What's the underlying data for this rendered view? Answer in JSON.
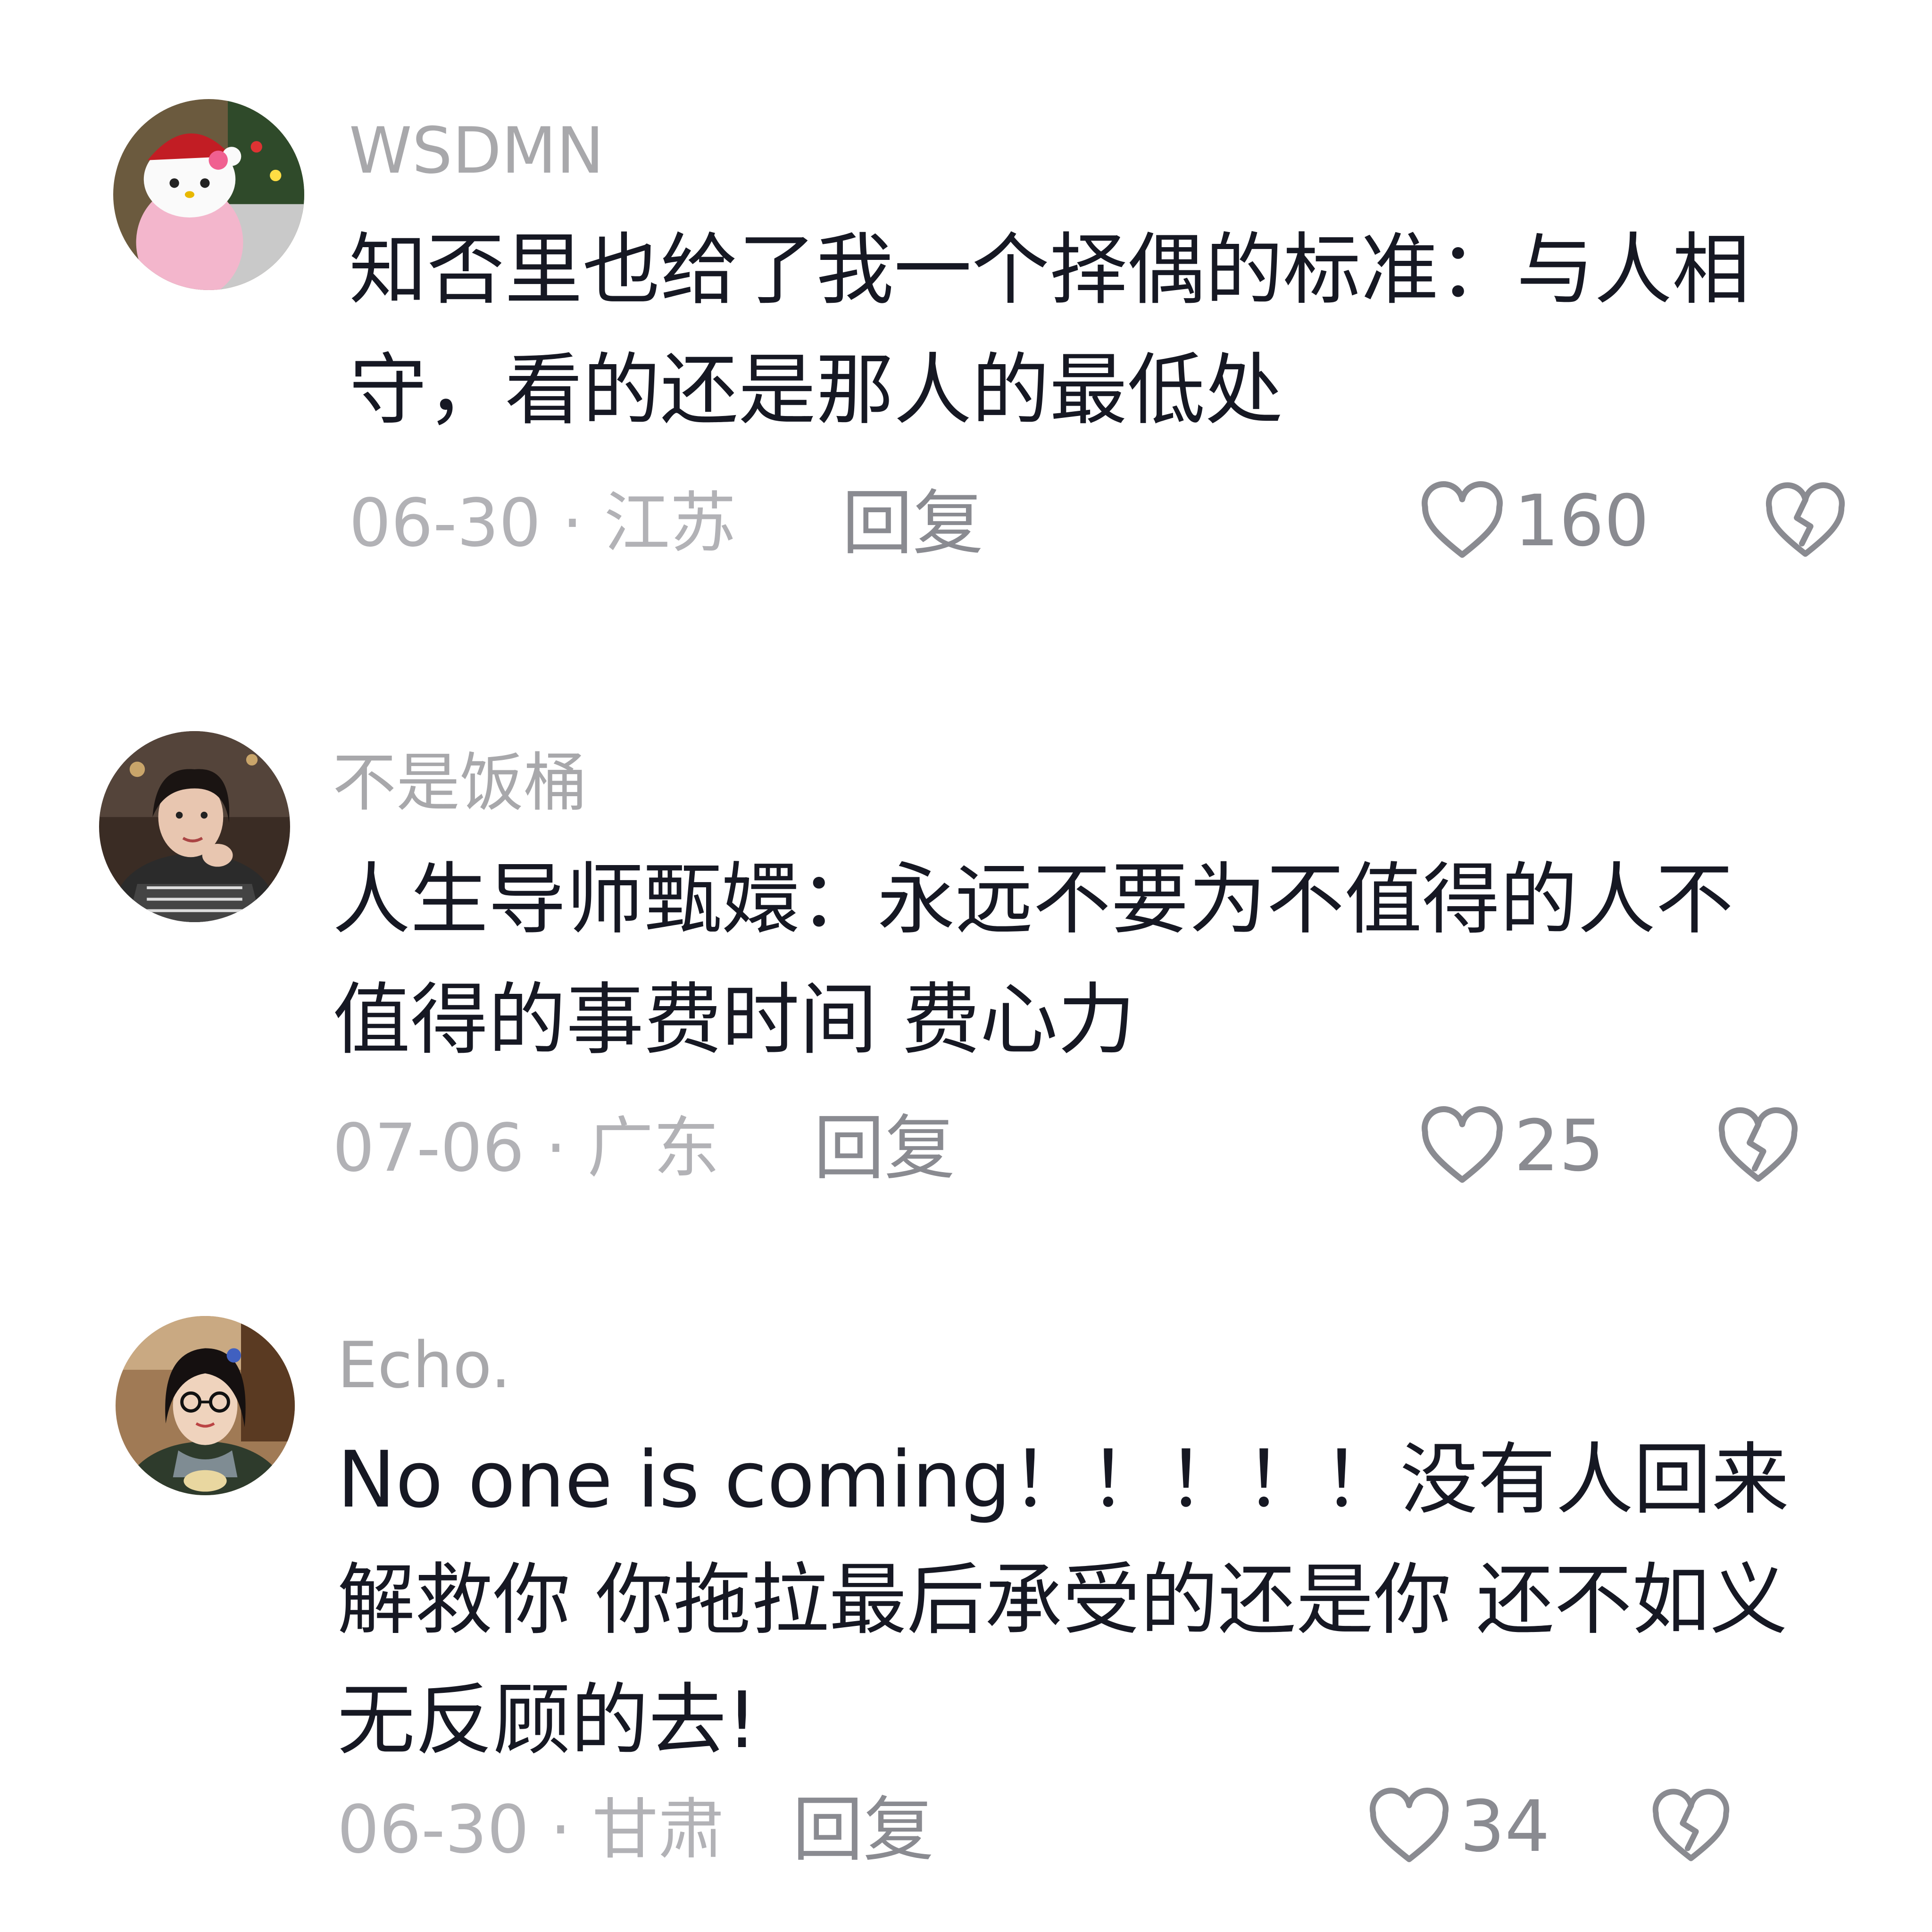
{
  "comments": [
    {
      "username": "WSDMN",
      "text": "知否里也给了我一个择偶的标准：与人相守，看的还是那人的最低处",
      "date_location": "06-30 · 江苏",
      "reply_label": "回复",
      "likes": "160",
      "avatar_icon": "hello-kitty-avatar"
    },
    {
      "username": "不是饭桶",
      "text": "人生导师甄嬛：永远不要为不值得的人不值得的事费时间 费心力",
      "date_location": "07-06 · 广东",
      "reply_label": "回复",
      "likes": "25",
      "avatar_icon": "woman-portrait-avatar"
    },
    {
      "username": "Echo.",
      "text": "No one is coming！！！！！没有人回来解救你 你拖拉最后承受的还是你 还不如义无反顾的去!",
      "date_location": "06-30 · 甘肃",
      "reply_label": "回复",
      "likes": "34",
      "avatar_icon": "woman-glasses-avatar"
    }
  ],
  "icons": {
    "like": "heart-outline-icon",
    "dislike": "broken-heart-icon"
  },
  "colors": {
    "text": "#161823",
    "username": "#a8a8ab",
    "meta": "#b2b2b6",
    "action": "#8a8b91"
  }
}
